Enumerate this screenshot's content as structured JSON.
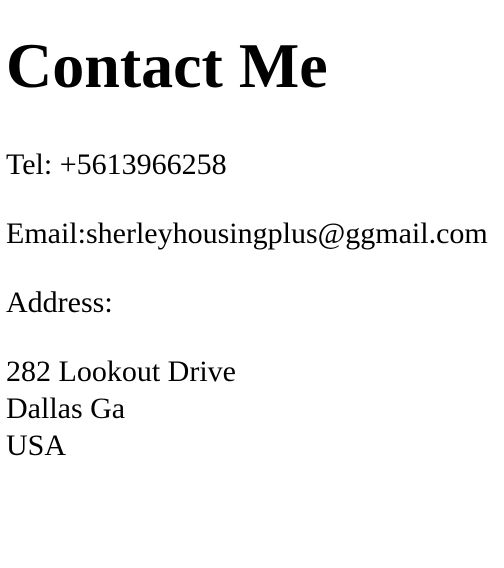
{
  "heading": "Contact Me",
  "tel": "Tel: +5613966258",
  "email": "Email:sherleyhousingplus@ggmail.com",
  "address_label": "Address:",
  "address_lines": [
    "282 Lookout Drive",
    "Dallas Ga",
    "USA"
  ]
}
